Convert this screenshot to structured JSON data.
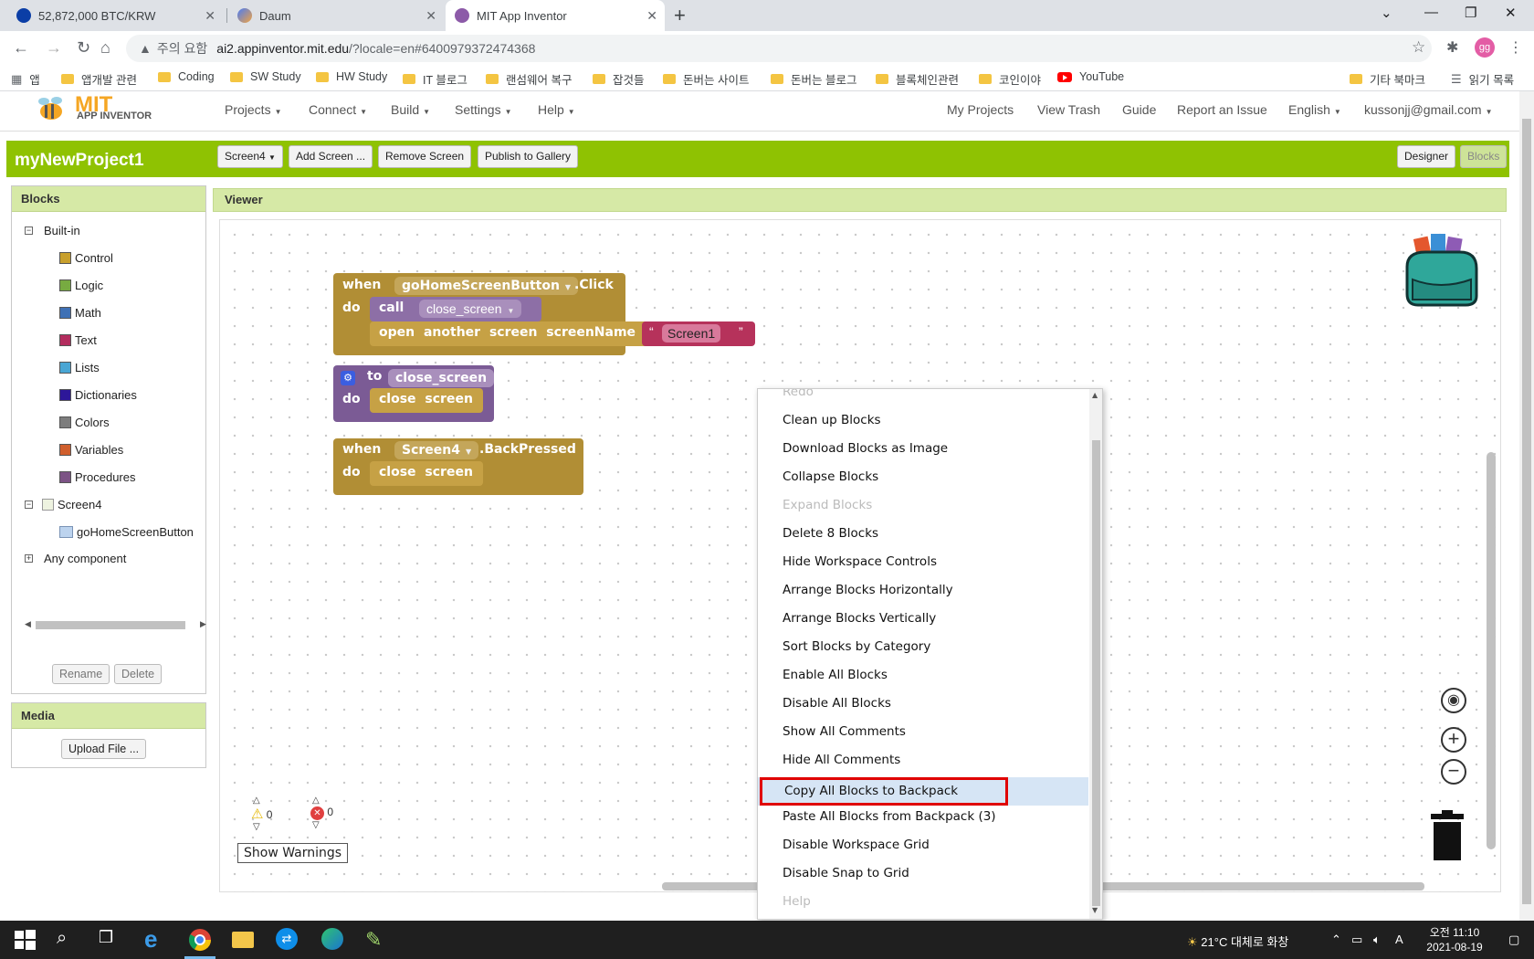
{
  "browser": {
    "tabs": [
      {
        "title": "52,872,000 BTC/KRW",
        "active": false
      },
      {
        "title": "Daum",
        "active": false
      },
      {
        "title": "MIT App Inventor",
        "active": true
      }
    ],
    "security_label": "주의 요함",
    "url_host": "ai2.appinventor.mit.edu",
    "url_rest": "/?locale=en#6400979372474368",
    "profile_initials": "gg",
    "bookmarks": [
      "앱",
      "앱개발 관련",
      "Coding",
      "SW Study",
      "HW Study",
      "IT 블로그",
      "랜섬웨어 복구",
      "잡것들",
      "돈버는 사이트",
      "돈버는 블로그",
      "블록체인관련",
      "코인이야",
      "YouTube",
      "기타 북마크",
      "읽기 목록"
    ]
  },
  "app": {
    "logo_mit": "MIT",
    "logo_sub": "APP INVENTOR",
    "left_menu": [
      "Projects",
      "Connect",
      "Build",
      "Settings",
      "Help"
    ],
    "right_menu": [
      "My Projects",
      "View Trash",
      "Guide",
      "Report an Issue",
      "English",
      "kussonjj@gmail.com"
    ],
    "project_name": "myNewProject1",
    "toolbar": {
      "screen_select": "Screen4",
      "add_screen": "Add Screen ...",
      "remove_screen": "Remove Screen",
      "publish": "Publish to Gallery",
      "designer": "Designer",
      "blocks": "Blocks"
    }
  },
  "blocks_panel": {
    "title": "Blocks",
    "builtin_label": "Built-in",
    "builtin": [
      {
        "label": "Control",
        "color": "#c8a02d"
      },
      {
        "label": "Logic",
        "color": "#77ab41"
      },
      {
        "label": "Math",
        "color": "#3f71b5"
      },
      {
        "label": "Text",
        "color": "#b32d5e"
      },
      {
        "label": "Lists",
        "color": "#49a6d4"
      },
      {
        "label": "Dictionaries",
        "color": "#2d1799"
      },
      {
        "label": "Colors",
        "color": "#7d7d7d"
      },
      {
        "label": "Variables",
        "color": "#d05f2d"
      },
      {
        "label": "Procedures",
        "color": "#7c5385"
      }
    ],
    "screen_label": "Screen4",
    "component_label": "goHomeScreenButton",
    "any_component": "Any component",
    "rename": "Rename",
    "delete": "Delete"
  },
  "media_panel": {
    "title": "Media",
    "upload": "Upload File ..."
  },
  "viewer": {
    "title": "Viewer",
    "block1": {
      "when": "when",
      "component": "goHomeScreenButton",
      "event": ".Click",
      "do": "do",
      "call": "call",
      "proc": "close_screen",
      "open_words": "open another screen screenName",
      "string": "Screen1"
    },
    "block2": {
      "to": "to",
      "proc": "close_screen",
      "do": "do",
      "body": "close screen"
    },
    "block3": {
      "when": "when",
      "component": "Screen4",
      "event": ".BackPressed",
      "do": "do",
      "body": "close screen"
    },
    "warnings_count": "0",
    "errors_count": "0",
    "show_warnings": "Show Warnings"
  },
  "context_menu": {
    "items": [
      {
        "label": "Redo",
        "disabled": true
      },
      {
        "label": "Clean up Blocks",
        "disabled": false
      },
      {
        "label": "Download Blocks as Image",
        "disabled": false
      },
      {
        "label": "Collapse Blocks",
        "disabled": false
      },
      {
        "label": "Expand Blocks",
        "disabled": true
      },
      {
        "label": "Delete 8 Blocks",
        "disabled": false
      },
      {
        "label": "Hide Workspace Controls",
        "disabled": false
      },
      {
        "label": "Arrange Blocks Horizontally",
        "disabled": false
      },
      {
        "label": "Arrange Blocks Vertically",
        "disabled": false
      },
      {
        "label": "Sort Blocks by Category",
        "disabled": false
      },
      {
        "label": "Enable All Blocks",
        "disabled": false
      },
      {
        "label": "Disable All Blocks",
        "disabled": false
      },
      {
        "label": "Show All Comments",
        "disabled": false
      },
      {
        "label": "Hide All Comments",
        "disabled": false
      },
      {
        "label": "Copy All Blocks to Backpack",
        "disabled": false,
        "highlighted": true
      },
      {
        "label": "Paste All Blocks from Backpack (3)",
        "disabled": false
      },
      {
        "label": "Disable Workspace Grid",
        "disabled": false
      },
      {
        "label": "Disable Snap to Grid",
        "disabled": false
      },
      {
        "label": "Help",
        "disabled": true
      }
    ]
  },
  "taskbar": {
    "weather": "21°C 대체로 화창",
    "time": "오전 11:10",
    "date": "2021-08-19"
  },
  "colors": {
    "accent_green": "#8fc202",
    "panel_head": "#d6e9a6",
    "event_block": "#b18e35",
    "procedure_block": "#7b5b95",
    "text_block": "#b6325b",
    "highlight_outline": "#e00000"
  }
}
